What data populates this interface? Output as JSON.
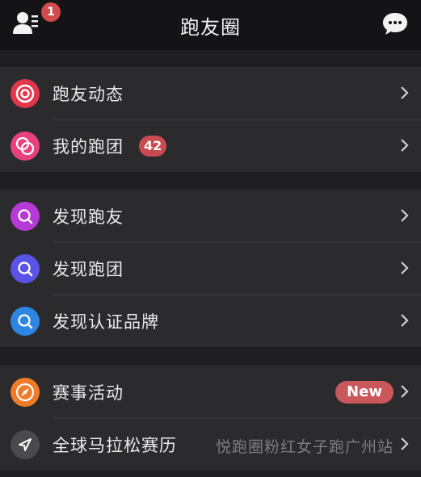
{
  "header": {
    "title": "跑友圈",
    "friend_badge": "1"
  },
  "section1": [
    {
      "label": "跑友动态",
      "icon": "target-icon"
    },
    {
      "label": "我的跑团",
      "icon": "rings-icon",
      "count": "42"
    }
  ],
  "section2": [
    {
      "label": "发现跑友",
      "icon": "search-icon"
    },
    {
      "label": "发现跑团",
      "icon": "search-icon"
    },
    {
      "label": "发现认证品牌",
      "icon": "search-icon"
    }
  ],
  "section3": [
    {
      "label": "赛事活动",
      "icon": "compass-icon",
      "badge": "New"
    },
    {
      "label": "全球马拉松赛历",
      "icon": "paper-plane-icon",
      "detail": "悦跑圈粉红女子跑广州站"
    }
  ],
  "colors": {
    "target": "#e2364c",
    "rings": "#e8417f",
    "discover_friends": "#b63ad6",
    "discover_teams": "#5a54e6",
    "discover_brands": "#2e86e2",
    "events": "#f07c2a",
    "calendar": "#4a4a4e"
  }
}
